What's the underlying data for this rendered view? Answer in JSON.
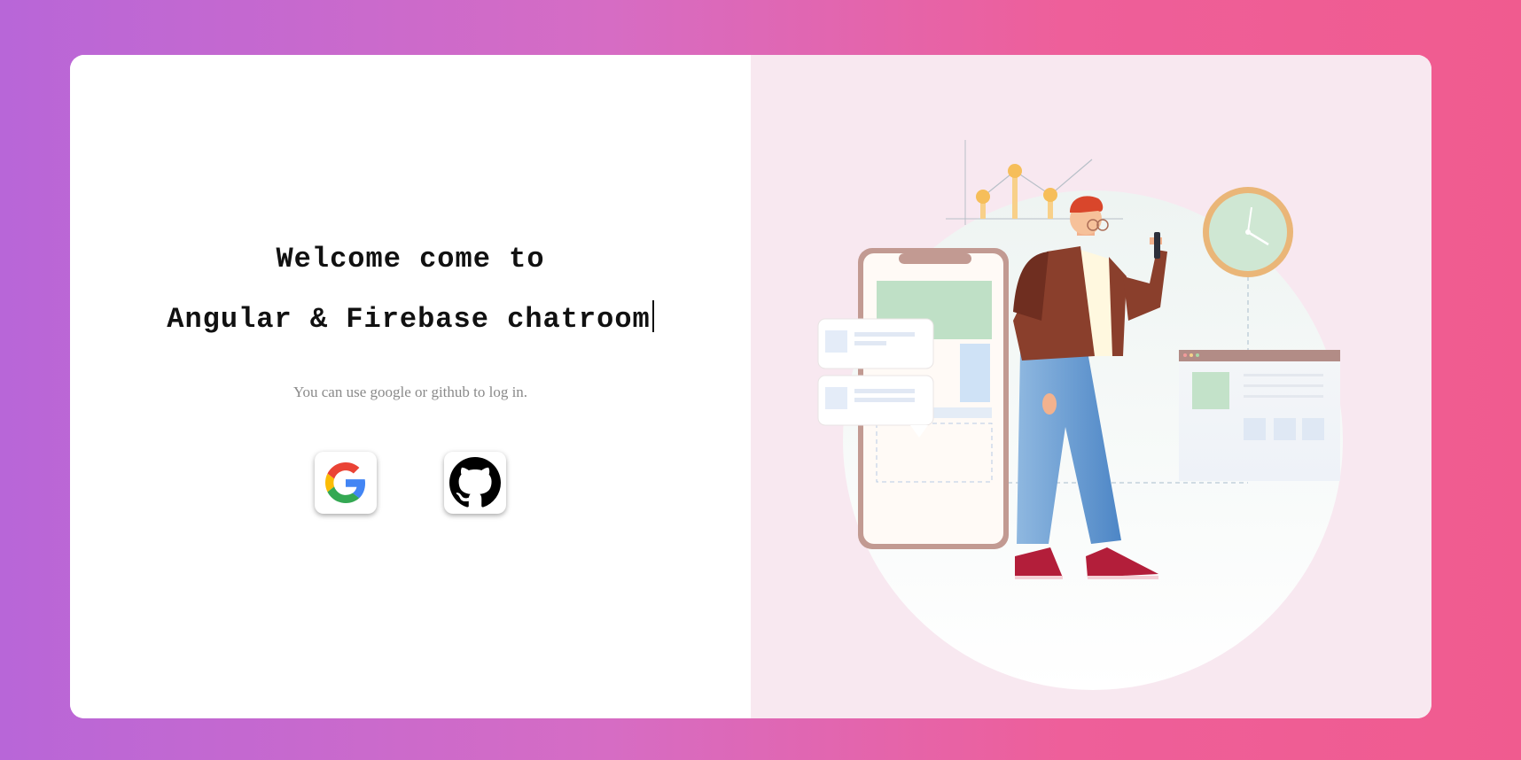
{
  "welcome": {
    "line1": "Welcome come to",
    "line2": "Angular & Firebase chatroom"
  },
  "login": {
    "hint": "You can use google or github to log in.",
    "google_icon": "google-icon",
    "github_icon": "github-icon"
  },
  "colors": {
    "background_start": "#b866d8",
    "background_end": "#f05b8f",
    "right_panel": "#f8e8f0"
  }
}
